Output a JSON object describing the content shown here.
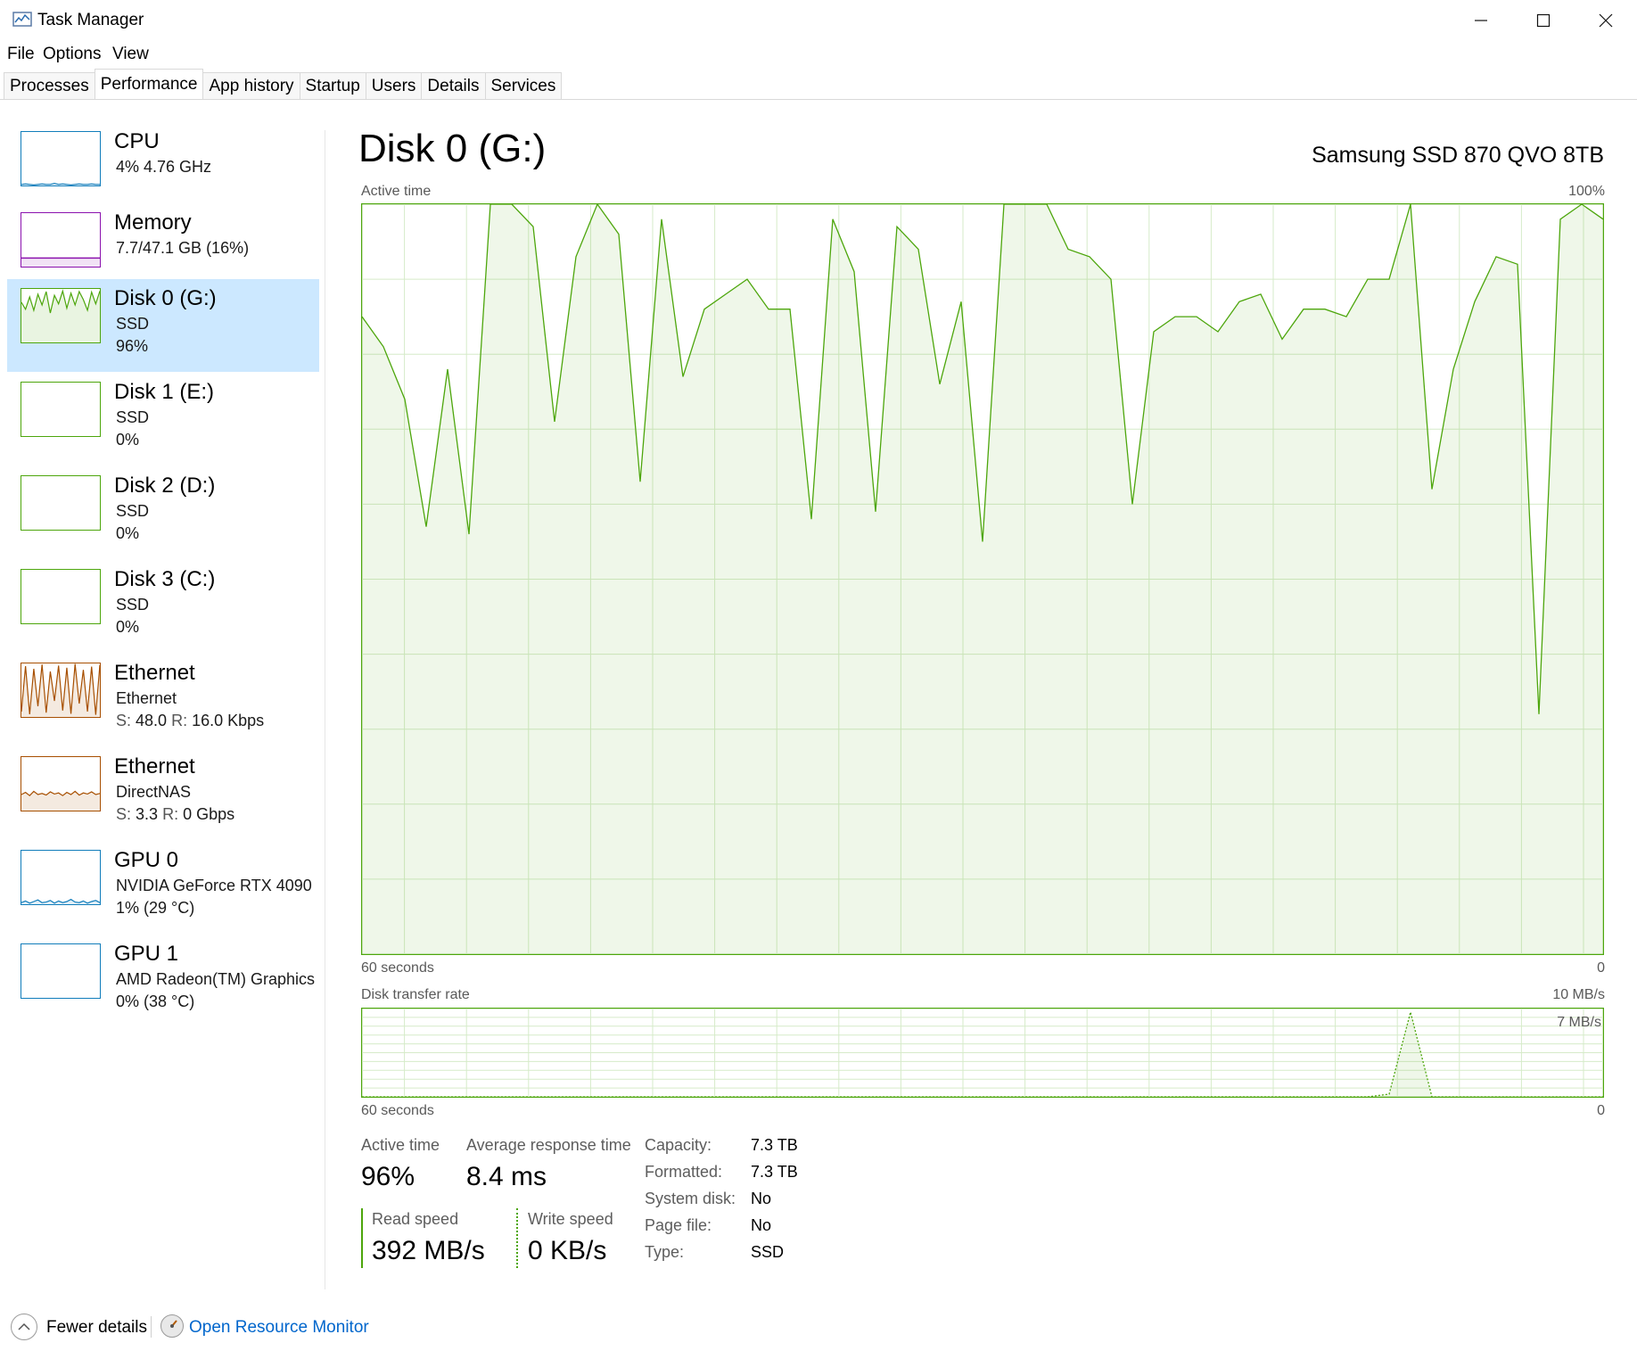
{
  "window": {
    "title": "Task Manager",
    "controls": {
      "minimize": "—",
      "maximize": "☐",
      "close": "✕"
    }
  },
  "menu": [
    "File",
    "Options",
    "View"
  ],
  "tabs": [
    {
      "label": "Processes"
    },
    {
      "label": "Performance",
      "active": true
    },
    {
      "label": "App history"
    },
    {
      "label": "Startup"
    },
    {
      "label": "Users"
    },
    {
      "label": "Details"
    },
    {
      "label": "Services"
    }
  ],
  "sidebar": {
    "items": [
      {
        "name": "CPU",
        "line2": "4%  4.76 GHz",
        "line3": "",
        "color": "#117dbb",
        "spark": [
          2,
          3,
          2,
          1,
          2,
          3,
          2,
          2,
          4,
          2,
          3,
          2,
          1,
          2,
          3,
          2,
          2,
          3,
          2,
          2
        ]
      },
      {
        "name": "Memory",
        "line2": "7.7/47.1 GB (16%)",
        "line3": "",
        "color": "#8b12ae",
        "fill_percent": 16
      },
      {
        "name": "Disk 0 (G:)",
        "line2": "SSD",
        "line3": "96%",
        "color": "#4da60c",
        "selected": true,
        "spark": [
          75,
          62,
          85,
          60,
          90,
          70,
          95,
          55,
          88,
          72,
          96,
          64,
          92,
          70,
          95,
          80,
          60,
          94,
          72,
          96
        ]
      },
      {
        "name": "Disk 1 (E:)",
        "line2": "SSD",
        "line3": "0%",
        "color": "#4da60c",
        "spark": []
      },
      {
        "name": "Disk 2 (D:)",
        "line2": "SSD",
        "line3": "0%",
        "color": "#4da60c",
        "spark": []
      },
      {
        "name": "Disk 3 (C:)",
        "line2": "SSD",
        "line3": "0%",
        "color": "#4da60c",
        "spark": []
      },
      {
        "name": "Ethernet",
        "line2": "Ethernet",
        "line3_label1": "S:",
        "line3_val1": "48.0",
        "line3_label2": "R:",
        "line3_val2": "16.0 Kbps",
        "color": "#a74f01",
        "spark": [
          10,
          95,
          5,
          90,
          20,
          98,
          8,
          85,
          30,
          96,
          12,
          92,
          6,
          99,
          25,
          88,
          10,
          94,
          4,
          97
        ]
      },
      {
        "name": "Ethernet",
        "line2": "DirectNAS",
        "line3_label1": "S:",
        "line3_val1": "3.3",
        "line3_label2": "R:",
        "line3_val2": "0 Gbps",
        "color": "#a74f01",
        "spark": [
          30,
          34,
          28,
          36,
          30,
          32,
          29,
          35,
          31,
          33,
          28,
          34,
          30,
          36,
          29,
          33,
          31,
          35,
          30,
          32
        ]
      },
      {
        "name": "GPU 0",
        "line2": "NVIDIA GeForce RTX 4090",
        "line3": "1%  (29 °C)",
        "color": "#117dbb",
        "spark": [
          3,
          6,
          2,
          5,
          8,
          3,
          4,
          7,
          2,
          6,
          3,
          5,
          9,
          4,
          3,
          6,
          2,
          5,
          7,
          3
        ]
      },
      {
        "name": "GPU 1",
        "line2": "AMD Radeon(TM) Graphics",
        "line3": "0%  (38 °C)",
        "color": "#117dbb",
        "spark": []
      }
    ]
  },
  "main": {
    "title": "Disk 0 (G:)",
    "model": "Samsung SSD 870 QVO 8TB",
    "active_chart": {
      "label": "Active time",
      "max_label": "100%",
      "left_bottom": "60 seconds",
      "right_bottom": "0"
    },
    "transfer_chart": {
      "label": "Disk transfer rate",
      "max_label": "10 MB/s",
      "mid_label": "7 MB/s",
      "left_bottom": "60 seconds",
      "right_bottom": "0"
    }
  },
  "stats": {
    "active_time_label": "Active time",
    "active_time_value": "96%",
    "avg_response_label": "Average response time",
    "avg_response_value": "8.4 ms",
    "read_speed_label": "Read speed",
    "read_speed_value": "392 MB/s",
    "write_speed_label": "Write speed",
    "write_speed_value": "0 KB/s"
  },
  "info": [
    {
      "label": "Capacity:",
      "value": "7.3 TB"
    },
    {
      "label": "Formatted:",
      "value": "7.3 TB"
    },
    {
      "label": "System disk:",
      "value": "No"
    },
    {
      "label": "Page file:",
      "value": "No"
    },
    {
      "label": "Type:",
      "value": "SSD"
    }
  ],
  "footer": {
    "fewer_details": "Fewer details",
    "open_resource_monitor": "Open Resource Monitor"
  },
  "colors": {
    "disk_line": "#4da60c",
    "disk_fill": "#eef6e8",
    "grid": "#d6ebc9",
    "selected_bg": "#cce8ff",
    "link": "#0066cc"
  },
  "chart_data": [
    {
      "type": "area",
      "title": "Active time",
      "ylabel": "",
      "xlabel": "60 seconds",
      "ylim": [
        0,
        100
      ],
      "x_range_seconds": [
        60,
        0
      ],
      "values": [
        85,
        81,
        74,
        57,
        78,
        56,
        100,
        100,
        97,
        71,
        93,
        100,
        96,
        63,
        98,
        77,
        86,
        88,
        90,
        86,
        86,
        58,
        98,
        91,
        59,
        97,
        94,
        76,
        87,
        55,
        100,
        100,
        100,
        94,
        93,
        90,
        60,
        83,
        85,
        85,
        83,
        87,
        88,
        82,
        86,
        86,
        85,
        90,
        90,
        100,
        62,
        78,
        87,
        93,
        92,
        32,
        98,
        100,
        98
      ]
    },
    {
      "type": "line",
      "title": "Disk transfer rate",
      "ylim": [
        0,
        10
      ],
      "ylabel_top": "10 MB/s",
      "values": [
        0,
        0,
        0,
        0,
        0,
        0,
        0,
        0,
        0,
        0,
        0,
        0,
        0,
        0,
        0,
        0,
        0,
        0,
        0,
        0,
        0,
        0,
        0,
        0,
        0,
        0,
        0,
        0,
        0,
        0,
        0,
        0,
        0,
        0,
        0,
        0,
        0,
        0,
        0,
        0,
        0,
        0,
        0,
        0,
        0,
        0,
        0,
        0,
        0.3,
        9.6,
        0,
        0,
        0,
        0,
        0,
        0,
        0,
        0,
        0
      ],
      "line_style": "dotted"
    }
  ]
}
